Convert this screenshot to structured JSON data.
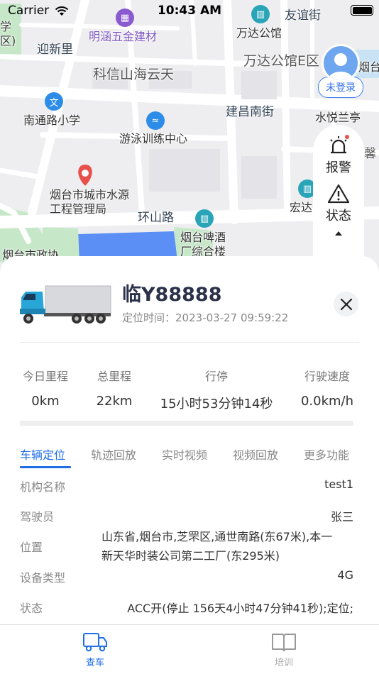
{
  "status_bar": {
    "carrier": "Carrier",
    "time": "10:43 AM"
  },
  "map": {
    "labels": {
      "mingshuo": "明涵五金建材",
      "youyijie": "友谊街",
      "wanda_apt": "万达公馆",
      "yingxinli": "迎新里",
      "kexin": "科信山海云天",
      "wanda_e": "万达公馆E区",
      "yantai_n": "烟台",
      "xue": "学",
      "qu": "区)",
      "nantong_school": "南通路小学",
      "jianchang": "建昌南街",
      "shuiyue": "水悦兰亭",
      "swim": "游泳训练中心",
      "xin": "馨",
      "water_mgmt": "烟台市城市水源工程管理局",
      "huanshan": "环山路",
      "beer": "烟台啤酒厂综合楼",
      "hongda": "宏达",
      "gov": "烟台市政协"
    }
  },
  "login": {
    "label": "未登录"
  },
  "side_panel": {
    "alarm_label": "报警",
    "status_label": "状态"
  },
  "vehicle": {
    "plate": "临Y88888",
    "locate_time_label": "定位时间：",
    "locate_time": "2023-03-27 09:59:22"
  },
  "stats": [
    {
      "label": "今日里程",
      "value": "0km"
    },
    {
      "label": "总里程",
      "value": "22km"
    },
    {
      "label": "行停",
      "value": "15小时53分钟14秒"
    },
    {
      "label": "行驶速度",
      "value": "0.0km/h"
    }
  ],
  "tabs": [
    "车辆定位",
    "轨迹回放",
    "实时视频",
    "视频回放",
    "更多功能"
  ],
  "details": {
    "org_label": "机构名称",
    "org_value": "test1",
    "driver_label": "驾驶员",
    "driver_value": "张三",
    "position_label": "位置",
    "position_line1": "山东省,烟台市,芝罘区,通世南路(东67米),本一",
    "position_line2": "新天华时装公司第二工厂(东295米)",
    "device_label": "设备类型",
    "device_value": "4G",
    "status_label": "状态",
    "status_value": "ACC开(停止 156天4小时47分钟41秒);定位;"
  },
  "bottom_nav": {
    "check_car": "查车",
    "training": "培训"
  },
  "colors": {
    "accent": "#1f6ee8",
    "map_bg": "#eeeef0",
    "water": "#5b8ff5",
    "poi_teal": "#2aa5b8",
    "poi_red": "#e8504a",
    "poi_purple": "#8a5ad0",
    "poi_blue": "#2c8ce8"
  }
}
